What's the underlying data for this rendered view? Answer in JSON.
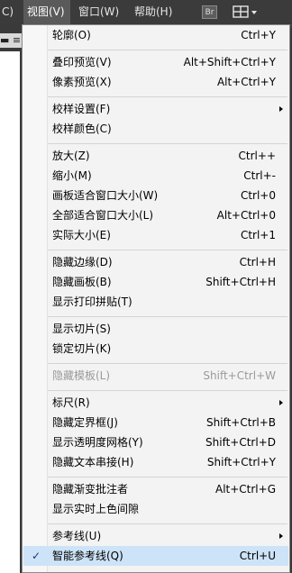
{
  "menubar": {
    "items": [
      {
        "label": "C)"
      },
      {
        "label": "视图(V)"
      },
      {
        "label": "窗口(W)"
      },
      {
        "label": "帮助(H)"
      }
    ],
    "br_label": "Br",
    "layout_icon": "layout-grid-icon",
    "left_tab_text": "▬ ≡"
  },
  "menu": {
    "items": [
      {
        "label": "轮廓(O)",
        "shortcut": "Ctrl+Y"
      },
      {
        "label": "叠印预览(V)",
        "shortcut": "Alt+Shift+Ctrl+Y"
      },
      {
        "label": "像素预览(X)",
        "shortcut": "Alt+Ctrl+Y"
      },
      {
        "label": "校样设置(F)",
        "shortcut": ""
      },
      {
        "label": "校样颜色(C)",
        "shortcut": ""
      },
      {
        "label": "放大(Z)",
        "shortcut": "Ctrl++"
      },
      {
        "label": "缩小(M)",
        "shortcut": "Ctrl+-"
      },
      {
        "label": "画板适合窗口大小(W)",
        "shortcut": "Ctrl+0"
      },
      {
        "label": "全部适合窗口大小(L)",
        "shortcut": "Alt+Ctrl+0"
      },
      {
        "label": "实际大小(E)",
        "shortcut": "Ctrl+1"
      },
      {
        "label": "隐藏边缘(D)",
        "shortcut": "Ctrl+H"
      },
      {
        "label": "隐藏画板(B)",
        "shortcut": "Shift+Ctrl+H"
      },
      {
        "label": "显示打印拼贴(T)",
        "shortcut": ""
      },
      {
        "label": "显示切片(S)",
        "shortcut": ""
      },
      {
        "label": "锁定切片(K)",
        "shortcut": ""
      },
      {
        "label": "隐藏模板(L)",
        "shortcut": "Shift+Ctrl+W"
      },
      {
        "label": "标尺(R)",
        "shortcut": ""
      },
      {
        "label": "隐藏定界框(J)",
        "shortcut": "Shift+Ctrl+B"
      },
      {
        "label": "显示透明度网格(Y)",
        "shortcut": "Shift+Ctrl+D"
      },
      {
        "label": "隐藏文本串接(H)",
        "shortcut": "Shift+Ctrl+Y"
      },
      {
        "label": "隐藏渐变批注者",
        "shortcut": "Alt+Ctrl+G"
      },
      {
        "label": "显示实时上色间隙",
        "shortcut": ""
      },
      {
        "label": "参考线(U)",
        "shortcut": ""
      },
      {
        "label": "智能参考线(Q)",
        "shortcut": "Ctrl+U",
        "check": "✓"
      }
    ]
  },
  "colors": {
    "menubar_bg": "#3b3b3b",
    "menu_bg": "#f3f3f3",
    "highlight": "#cde3f7",
    "disabled_text": "#9a9a9a"
  }
}
